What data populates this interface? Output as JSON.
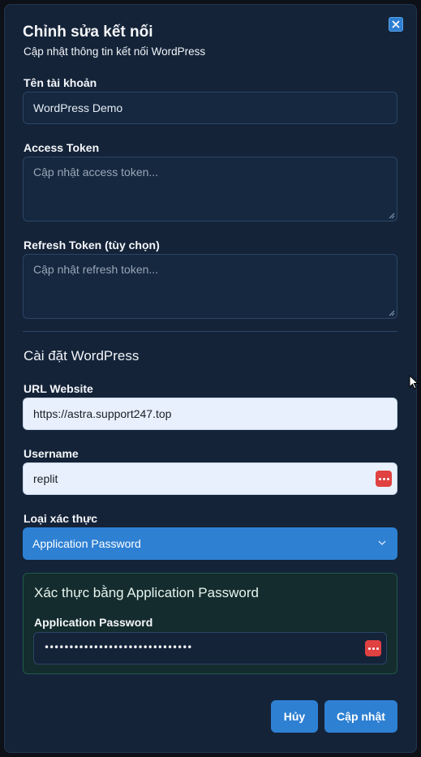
{
  "dialog": {
    "title": "Chỉnh sửa kết nối",
    "subtitle": "Cập nhật thông tin kết nối WordPress"
  },
  "fields": {
    "account_name": {
      "label": "Tên tài khoản",
      "value": "WordPress Demo"
    },
    "access_token": {
      "label": "Access Token",
      "placeholder": "Cập nhật access token..."
    },
    "refresh_token": {
      "label": "Refresh Token (tùy chọn)",
      "placeholder": "Cập nhật refresh token..."
    }
  },
  "wordpress": {
    "section_title": "Cài đặt WordPress",
    "url": {
      "label": "URL Website",
      "value": "https://astra.support247.top"
    },
    "username": {
      "label": "Username",
      "value": "replit"
    },
    "auth_type": {
      "label": "Loại xác thực",
      "selected": "Application Password"
    },
    "app_password": {
      "box_title": "Xác thực bằng Application Password",
      "label": "Application Password",
      "masked_value": "••••••••••••••••••••••••••••••"
    }
  },
  "buttons": {
    "cancel": "Hủy",
    "update": "Cập nhật"
  },
  "colors": {
    "modal_bg": "#142338",
    "accent": "#2e80d3",
    "password_manager_icon": "#e04141",
    "app_box_bg": "#152c2e"
  },
  "icons": [
    "close-icon",
    "password-manager-icon",
    "chevron-down-icon",
    "cursor-icon"
  ]
}
